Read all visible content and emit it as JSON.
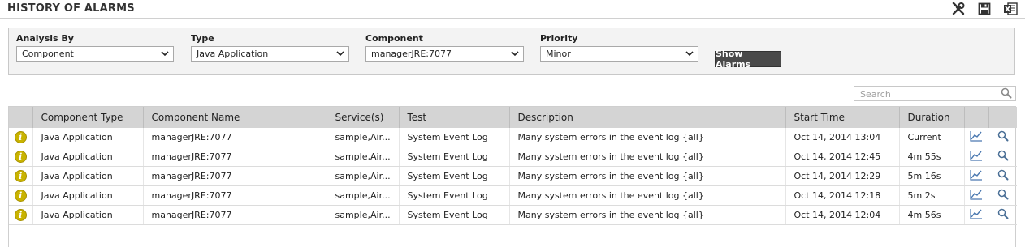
{
  "page": {
    "title": "HISTORY OF ALARMS"
  },
  "toolbar": {
    "icons": [
      "tools-icon",
      "save-icon",
      "excel-export-icon"
    ]
  },
  "filters": {
    "analysis_by": {
      "label": "Analysis By",
      "value": "Component"
    },
    "type": {
      "label": "Type",
      "value": "Java Application"
    },
    "component": {
      "label": "Component",
      "value": "managerJRE:7077"
    },
    "priority": {
      "label": "Priority",
      "value": "Minor"
    },
    "show_button": "Show Alarms"
  },
  "search": {
    "placeholder": "Search",
    "value": ""
  },
  "table": {
    "columns": [
      "Component Type",
      "Component Name",
      "Service(s)",
      "Test",
      "Description",
      "Start Time",
      "Duration"
    ],
    "rows": [
      {
        "type": "Java Application",
        "name": "managerJRE:7077",
        "services": "sample,Air...",
        "test": "System Event Log",
        "description": "Many system errors in the event log {all}",
        "start": "Oct 14, 2014 13:04",
        "duration": "Current"
      },
      {
        "type": "Java Application",
        "name": "managerJRE:7077",
        "services": "sample,Air...",
        "test": "System Event Log",
        "description": "Many system errors in the event log {all}",
        "start": "Oct 14, 2014 12:45",
        "duration": "4m 55s"
      },
      {
        "type": "Java Application",
        "name": "managerJRE:7077",
        "services": "sample,Air...",
        "test": "System Event Log",
        "description": "Many system errors in the event log {all}",
        "start": "Oct 14, 2014 12:29",
        "duration": "5m 16s"
      },
      {
        "type": "Java Application",
        "name": "managerJRE:7077",
        "services": "sample,Air...",
        "test": "System Event Log",
        "description": "Many system errors in the event log {all}",
        "start": "Oct 14, 2014 12:18",
        "duration": "5m 2s"
      },
      {
        "type": "Java Application",
        "name": "managerJRE:7077",
        "services": "sample,Air...",
        "test": "System Event Log",
        "description": "Many system errors in the event log {all}",
        "start": "Oct 14, 2014 12:04",
        "duration": "4m 56s"
      }
    ],
    "row_icon": "i"
  },
  "colors": {
    "header_bg": "#d4d4d4",
    "info_icon": "#c9b300",
    "button_bg": "#4a4a4a",
    "panel_bg": "#f3f3f3"
  }
}
